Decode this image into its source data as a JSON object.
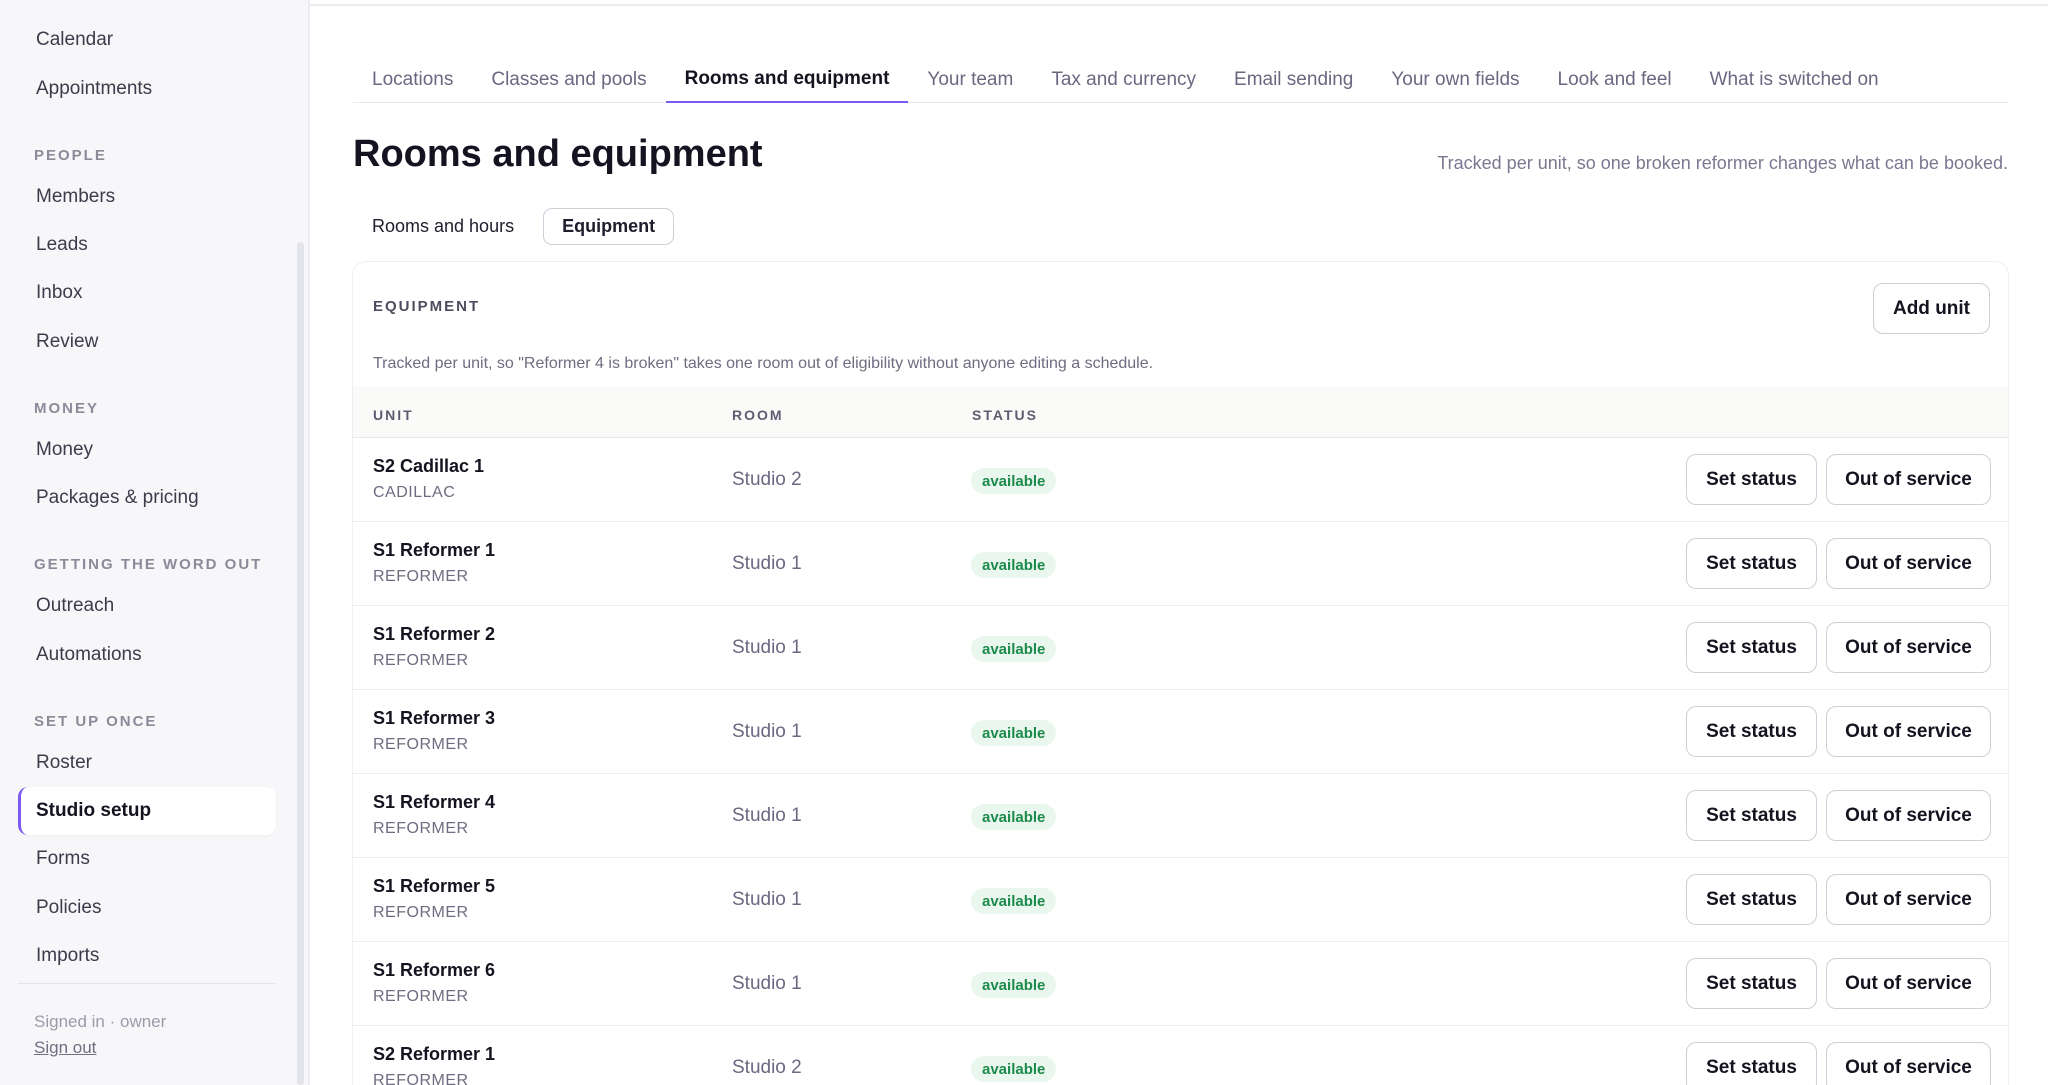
{
  "sidebar": {
    "top_items": [
      "Calendar",
      "Appointments"
    ],
    "sections": [
      {
        "title": "PEOPLE",
        "items": [
          "Members",
          "Leads",
          "Inbox",
          "Review"
        ]
      },
      {
        "title": "MONEY",
        "items": [
          "Money",
          "Packages & pricing"
        ]
      },
      {
        "title": "GETTING THE WORD OUT",
        "items": [
          "Outreach",
          "Automations"
        ]
      },
      {
        "title": "SET UP ONCE",
        "items": [
          "Roster",
          "Studio setup",
          "Forms",
          "Policies",
          "Imports"
        ]
      }
    ],
    "active_item": "Studio setup",
    "signed_in": "Signed in · owner",
    "sign_out": "Sign out"
  },
  "tabs": [
    "Locations",
    "Classes and pools",
    "Rooms and equipment",
    "Your team",
    "Tax and currency",
    "Email sending",
    "Your own fields",
    "Look and feel",
    "What is switched on"
  ],
  "active_tab": "Rooms and equipment",
  "page": {
    "title": "Rooms and equipment",
    "note": "Tracked per unit, so one broken reformer changes what can be booked."
  },
  "subtabs": [
    "Rooms and hours",
    "Equipment"
  ],
  "active_subtab": "Equipment",
  "panel": {
    "label": "EQUIPMENT",
    "add_button": "Add unit",
    "description": "Tracked per unit, so \"Reformer 4 is broken\" takes one room out of eligibility without anyone editing a schedule.",
    "columns": [
      "UNIT",
      "ROOM",
      "STATUS"
    ],
    "set_status_label": "Set status",
    "out_of_service_label": "Out of service",
    "rows": [
      {
        "name": "S2 Cadillac 1",
        "type": "CADILLAC",
        "room": "Studio 2",
        "status": "available"
      },
      {
        "name": "S1 Reformer 1",
        "type": "REFORMER",
        "room": "Studio 1",
        "status": "available"
      },
      {
        "name": "S1 Reformer 2",
        "type": "REFORMER",
        "room": "Studio 1",
        "status": "available"
      },
      {
        "name": "S1 Reformer 3",
        "type": "REFORMER",
        "room": "Studio 1",
        "status": "available"
      },
      {
        "name": "S1 Reformer 4",
        "type": "REFORMER",
        "room": "Studio 1",
        "status": "available"
      },
      {
        "name": "S1 Reformer 5",
        "type": "REFORMER",
        "room": "Studio 1",
        "status": "available"
      },
      {
        "name": "S1 Reformer 6",
        "type": "REFORMER",
        "room": "Studio 1",
        "status": "available"
      },
      {
        "name": "S2 Reformer 1",
        "type": "REFORMER",
        "room": "Studio 2",
        "status": "available"
      }
    ]
  },
  "colors": {
    "accent": "#7a5af0",
    "status_available_text": "#1c8a4b",
    "status_available_bg": "#eaf7ef"
  }
}
